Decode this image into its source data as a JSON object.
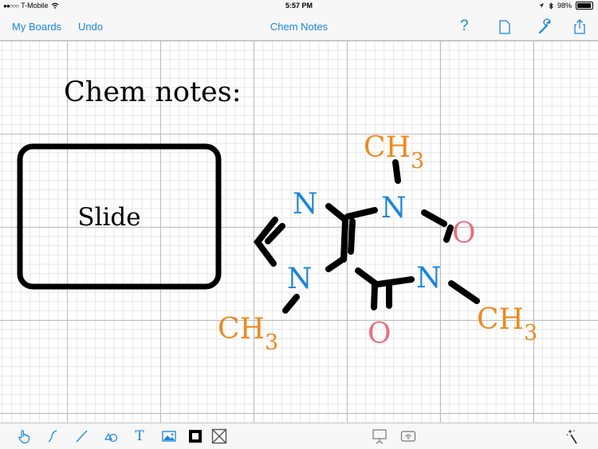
{
  "status_bar": {
    "carrier": "T-Mobile",
    "time": "5:57 PM",
    "battery": "98%"
  },
  "nav": {
    "my_boards": "My Boards",
    "undo": "Undo",
    "title": "Chem Notes",
    "help": "?"
  },
  "canvas": {
    "heading": "Chem notes:",
    "slide_label": "Slide",
    "molecule": {
      "n_top": "N",
      "n_upper_right": "N",
      "n_left": "N",
      "n_lower_right": "N",
      "o_right": "O",
      "o_bottom": "O",
      "ch_top": "CH",
      "ch_left": "CH",
      "ch_right": "CH",
      "sub": "3"
    }
  },
  "toolbar": {
    "text_tool": "T"
  },
  "colors": {
    "accent": "#1a86d8",
    "nitrogen": "#1a86d8",
    "oxygen": "#e8707a",
    "methyl": "#ec8a1e",
    "ink": "#000000"
  }
}
